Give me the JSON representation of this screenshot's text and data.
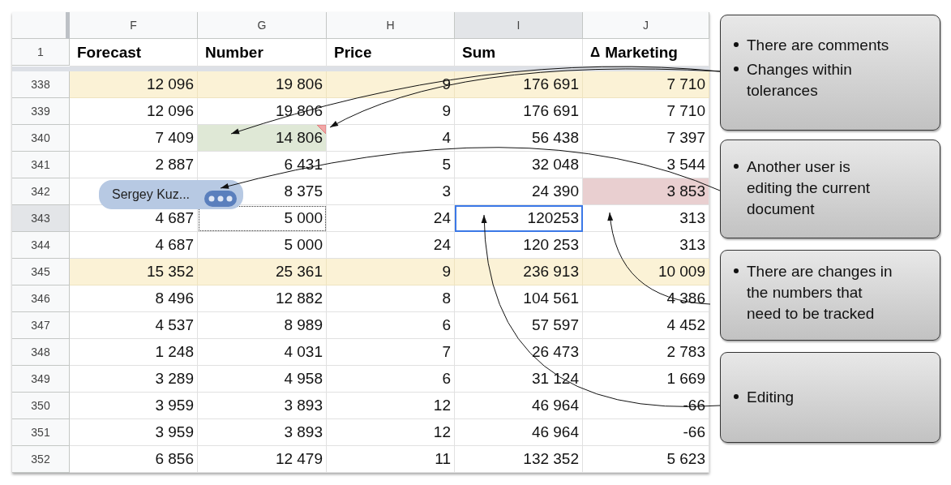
{
  "columns": [
    {
      "letter": "F",
      "selected": false
    },
    {
      "letter": "G",
      "selected": false
    },
    {
      "letter": "H",
      "selected": false
    },
    {
      "letter": "I",
      "selected": true
    },
    {
      "letter": "J",
      "selected": false
    }
  ],
  "header_row": {
    "number": "1",
    "cells": [
      "Forecast",
      "Number",
      "Price",
      "Sum",
      "Marketing"
    ],
    "delta_mark": "Δ"
  },
  "rows": [
    {
      "number": "338",
      "selected": false,
      "highlight": true,
      "cells": [
        "12 096",
        "19 806",
        "9",
        "176 691",
        "7 710"
      ]
    },
    {
      "number": "339",
      "selected": false,
      "highlight": false,
      "cells": [
        "12 096",
        "19 806",
        "9",
        "176 691",
        "7 710"
      ]
    },
    {
      "number": "340",
      "selected": false,
      "highlight": false,
      "cells": [
        "7 409",
        {
          "text": "14 806",
          "kind": "changed",
          "comment": true
        },
        "4",
        "56 438",
        "7 397"
      ]
    },
    {
      "number": "341",
      "selected": false,
      "highlight": false,
      "cells": [
        "2 887",
        "6 431",
        "5",
        "32 048",
        "3 544"
      ]
    },
    {
      "number": "342",
      "selected": false,
      "highlight": false,
      "presence": "Sergey Kuz...",
      "cells": [
        "",
        "8 375",
        "3",
        "24 390",
        {
          "text": "3 853",
          "kind": "alert"
        }
      ]
    },
    {
      "number": "343",
      "selected": true,
      "highlight": false,
      "cells": [
        "4 687",
        {
          "text": "5 000",
          "kind": "copied"
        },
        "24",
        {
          "text": "120253",
          "kind": "editing"
        },
        "313"
      ]
    },
    {
      "number": "344",
      "selected": false,
      "highlight": false,
      "cells": [
        "4 687",
        "5 000",
        "24",
        "120 253",
        "313"
      ]
    },
    {
      "number": "345",
      "selected": false,
      "highlight": true,
      "cells": [
        "15 352",
        "25 361",
        "9",
        "236 913",
        "10 009"
      ]
    },
    {
      "number": "346",
      "selected": false,
      "highlight": false,
      "cells": [
        "8 496",
        "12 882",
        "8",
        "104 561",
        "4 386"
      ]
    },
    {
      "number": "347",
      "selected": false,
      "highlight": false,
      "cells": [
        "4 537",
        "8 989",
        "6",
        "57 597",
        "4 452"
      ]
    },
    {
      "number": "348",
      "selected": false,
      "highlight": false,
      "cells": [
        "1 248",
        "4 031",
        "7",
        "26 473",
        "2 783"
      ]
    },
    {
      "number": "349",
      "selected": false,
      "highlight": false,
      "cells": [
        "3 289",
        "4 958",
        "6",
        "31 124",
        "1 669"
      ]
    },
    {
      "number": "350",
      "selected": false,
      "highlight": false,
      "cells": [
        "3 959",
        "3 893",
        "12",
        "46 964",
        "-66"
      ]
    },
    {
      "number": "351",
      "selected": false,
      "highlight": false,
      "cells": [
        "3 959",
        "3 893",
        "12",
        "46 964",
        "-66"
      ]
    },
    {
      "number": "352",
      "selected": false,
      "highlight": false,
      "cells": [
        "6 856",
        "12 479",
        "11",
        "132 352",
        "5 623"
      ]
    }
  ],
  "callouts": [
    {
      "items": [
        "There are comments",
        "Changes within tolerances"
      ]
    },
    {
      "items": [
        "Another user is editing the current document"
      ]
    },
    {
      "items": [
        "There are changes in the numbers that need to be tracked"
      ]
    },
    {
      "items": [
        "Editing"
      ]
    }
  ]
}
